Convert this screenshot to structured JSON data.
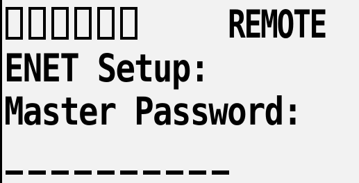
{
  "display": {
    "status_cells": [
      "",
      "",
      "",
      "",
      "",
      ""
    ],
    "mode": "REMOTE",
    "menu_title": "ENET Setup:",
    "prompt": "Master Password:",
    "entry_slots": [
      "",
      "",
      "",
      "",
      "",
      "",
      "",
      "",
      "",
      ""
    ]
  },
  "colors": {
    "background": "#f2f2f2",
    "foreground": "#000000"
  }
}
